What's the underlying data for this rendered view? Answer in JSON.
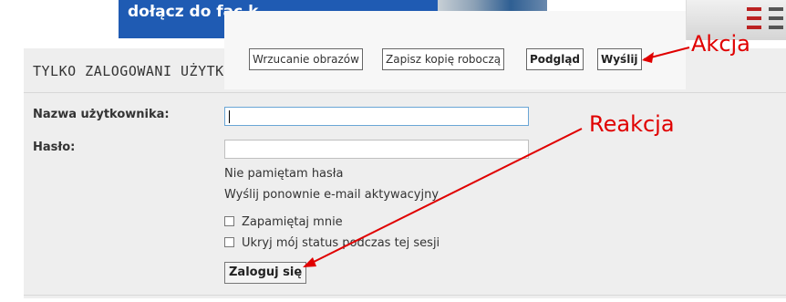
{
  "banner": {
    "text": "dołącz do                fac     k"
  },
  "toolbar": {
    "upload_label": "Wrzucanie obrazów",
    "save_draft_label": "Zapisz kopię roboczą",
    "preview_label": "Podgląd",
    "submit_label": "Wyślij"
  },
  "login": {
    "title": "TYLKO ZALOGOWANI UŻYTKO",
    "username_label": "Nazwa użytkownika:",
    "username_value": "",
    "password_label": "Hasło:",
    "password_value": "",
    "forgot_password": "Nie pamiętam hasła",
    "resend_activation": "Wyślij ponownie e-mail aktywacyjny",
    "remember_me": "Zapamiętaj mnie",
    "hide_status": "Ukryj mój status podczas tej sesji",
    "submit_label": "Zaloguj się"
  },
  "annotations": {
    "action": "Akcja",
    "reaction": "Reakcja",
    "color": "#e00000"
  }
}
